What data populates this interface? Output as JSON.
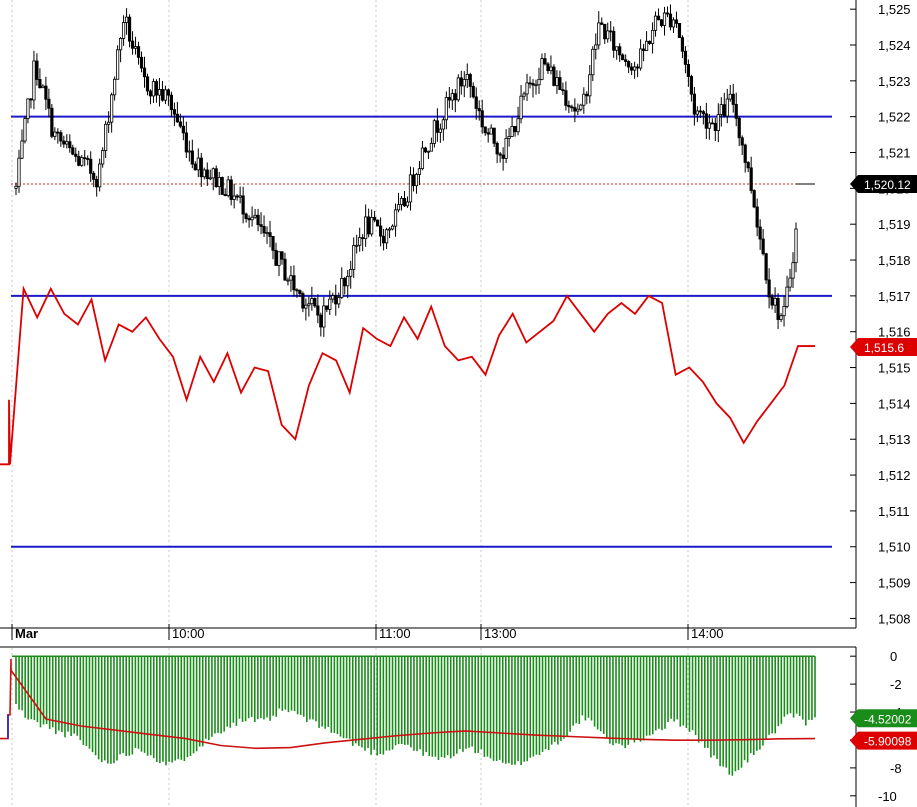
{
  "chart_data": [
    {
      "type": "candlestick",
      "title": "",
      "x_labels": [
        "Mar",
        "10:00",
        "11:00",
        "13:00",
        "14:00"
      ],
      "y_tick_labels": [
        "1,525",
        "1,524",
        "1,523",
        "1,522",
        "1,521",
        "1,520",
        "1,519",
        "1,518",
        "1,517",
        "1,516",
        "1,515",
        "1,514",
        "1,513",
        "1,512",
        "1,511",
        "1,510",
        "1,509",
        "1,508"
      ],
      "ylim": [
        1507.9,
        1525.2
      ],
      "last_price": 1520.12,
      "last_price_label": "1,520.12",
      "horizontal_lines": [
        {
          "value": 1522.0,
          "color": "#1a1acc"
        },
        {
          "value": 1517.0,
          "color": "#1a1acc"
        },
        {
          "value": 1510.0,
          "color": "#1a1acc"
        }
      ],
      "price_path_anchors": [
        [
          0,
          1520.0
        ],
        [
          3,
          1523.5
        ],
        [
          6,
          1521.5
        ],
        [
          9,
          1520.9
        ],
        [
          13,
          1520.3
        ],
        [
          17,
          1524.8
        ],
        [
          20,
          1523.0
        ],
        [
          24,
          1522.5
        ],
        [
          28,
          1520.8
        ],
        [
          32,
          1520.2
        ],
        [
          36,
          1519.5
        ],
        [
          40,
          1518.4
        ],
        [
          44,
          1517.2
        ],
        [
          48,
          1516.4
        ],
        [
          52,
          1517.5
        ],
        [
          55,
          1519.0
        ],
        [
          58,
          1518.7
        ],
        [
          61,
          1519.5
        ],
        [
          64,
          1521.0
        ],
        [
          68,
          1522.3
        ],
        [
          71,
          1523.2
        ],
        [
          74,
          1521.6
        ],
        [
          77,
          1521.0
        ],
        [
          80,
          1522.5
        ],
        [
          83,
          1523.5
        ],
        [
          86,
          1522.8
        ],
        [
          89,
          1522.0
        ],
        [
          92,
          1524.6
        ],
        [
          95,
          1523.8
        ],
        [
          98,
          1523.4
        ],
        [
          101,
          1524.7
        ],
        [
          104,
          1524.8
        ],
        [
          107,
          1522.2
        ],
        [
          110,
          1521.8
        ],
        [
          113,
          1522.5
        ],
        [
          116,
          1520.0
        ],
        [
          119,
          1517.0
        ],
        [
          121,
          1516.3
        ],
        [
          123,
          1518.8
        ]
      ],
      "series": [
        {
          "name": "",
          "type": "line",
          "color": "#dd0000",
          "last_value": 1515.6,
          "last_label": "1,515.6",
          "values": [
            1512.3,
            1517.2,
            1516.4,
            1517.2,
            1516.5,
            1516.2,
            1516.9,
            1515.2,
            1516.2,
            1516.0,
            1516.4,
            1515.8,
            1515.3,
            1514.1,
            1515.3,
            1514.6,
            1515.4,
            1514.3,
            1515.0,
            1514.9,
            1513.4,
            1513.0,
            1514.5,
            1515.4,
            1515.2,
            1514.3,
            1516.1,
            1515.8,
            1515.6,
            1516.4,
            1515.8,
            1516.7,
            1515.6,
            1515.2,
            1515.3,
            1514.8,
            1515.9,
            1516.5,
            1515.7,
            1516.0,
            1516.3,
            1517.0,
            1516.5,
            1516.0,
            1516.5,
            1516.8,
            1516.5,
            1517.0,
            1516.8,
            1514.8,
            1515.0,
            1514.6,
            1514.0,
            1513.6,
            1512.9,
            1513.5,
            1514.0,
            1514.5,
            1515.6
          ]
        }
      ]
    },
    {
      "type": "bar",
      "title": "",
      "y_tick_labels": [
        "0",
        "-2",
        "-4",
        "-6",
        "-8",
        "-10"
      ],
      "ylim": [
        -10.3,
        0.3
      ],
      "bar_color": "#1a8c1a",
      "bar_values": [
        -3.5,
        -4.4,
        -4.8,
        -5.0,
        -5.4,
        -5.6,
        -5.8,
        -6.5,
        -7.2,
        -7.7,
        -7.3,
        -7.0,
        -6.6,
        -6.9,
        -7.4,
        -7.8,
        -7.6,
        -7.1,
        -6.5,
        -6.0,
        -5.4,
        -5.0,
        -4.7,
        -4.5,
        -4.7,
        -4.6,
        -4.0,
        -3.9,
        -4.2,
        -4.7,
        -4.9,
        -5.3,
        -5.7,
        -6.1,
        -6.5,
        -6.8,
        -7.0,
        -6.6,
        -6.2,
        -6.5,
        -6.9,
        -7.2,
        -7.4,
        -7.1,
        -6.8,
        -6.6,
        -6.9,
        -7.3,
        -7.7,
        -7.9,
        -7.6,
        -7.2,
        -6.9,
        -6.4,
        -5.9,
        -5.2,
        -4.4,
        -4.8,
        -5.7,
        -6.2,
        -6.5,
        -6.1,
        -5.9,
        -5.4,
        -5.1,
        -4.6,
        -4.9,
        -5.5,
        -6.4,
        -7.3,
        -8.0,
        -8.5,
        -7.7,
        -6.9,
        -6.2,
        -5.4,
        -4.5,
        -4.2,
        -4.8,
        -4.6
      ],
      "series": [
        {
          "name": "",
          "color": "#cc1111",
          "last_value": -5.90098,
          "last_label": "-5.90098",
          "values": [
            -1.0,
            -4.5,
            -5.0,
            -5.3,
            -5.6,
            -5.9,
            -6.4,
            -6.6,
            -6.55,
            -6.2,
            -5.95,
            -5.7,
            -5.5,
            -5.35,
            -5.5,
            -5.65,
            -5.75,
            -5.85,
            -5.95,
            -6.02,
            -6.02,
            -5.98,
            -5.92,
            -5.9
          ]
        },
        {
          "name": "",
          "color": "#1a8c1a",
          "last_value": -4.52002,
          "last_label": "-4.52002"
        }
      ]
    }
  ]
}
